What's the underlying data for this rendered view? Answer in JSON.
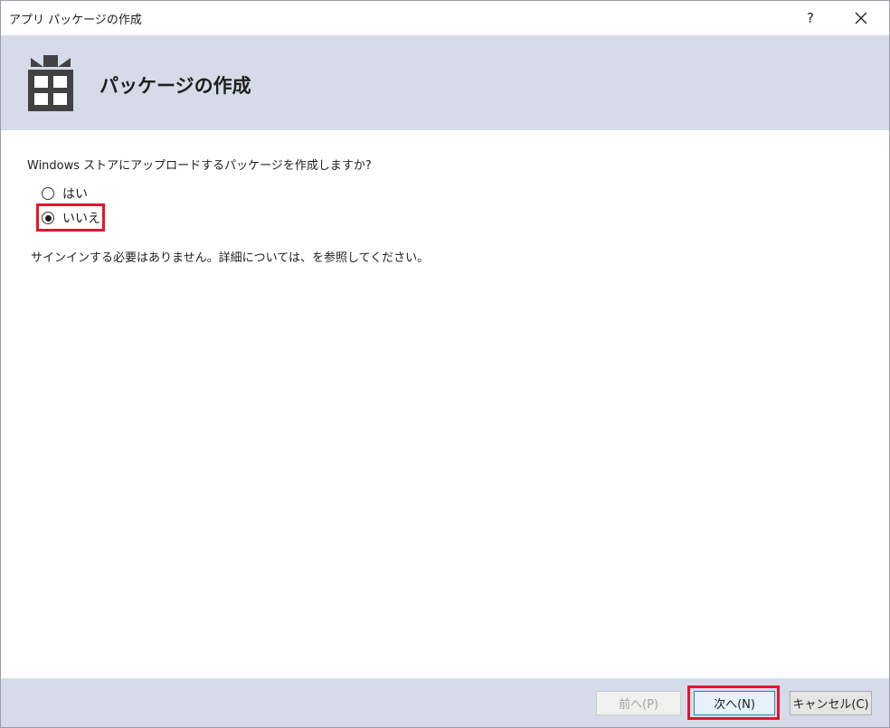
{
  "window": {
    "title": "アプリ パッケージの作成",
    "help_label": "?",
    "close_label": "✕"
  },
  "header": {
    "title": "パッケージの作成",
    "icon": "package-icon"
  },
  "content": {
    "question": "Windows ストアにアップロードするパッケージを作成しますか?",
    "options": [
      {
        "label": "はい",
        "selected": false
      },
      {
        "label": "いいえ",
        "selected": true
      }
    ],
    "info": "サインインする必要はありません。詳細については、を参照してください。"
  },
  "footer": {
    "back_label": "前へ(P)",
    "next_label": "次へ(N)",
    "cancel_label": "キャンセル(C)"
  },
  "colors": {
    "header_bg": "#d6dbe9",
    "highlight": "#e3162b",
    "icon": "#424242"
  }
}
